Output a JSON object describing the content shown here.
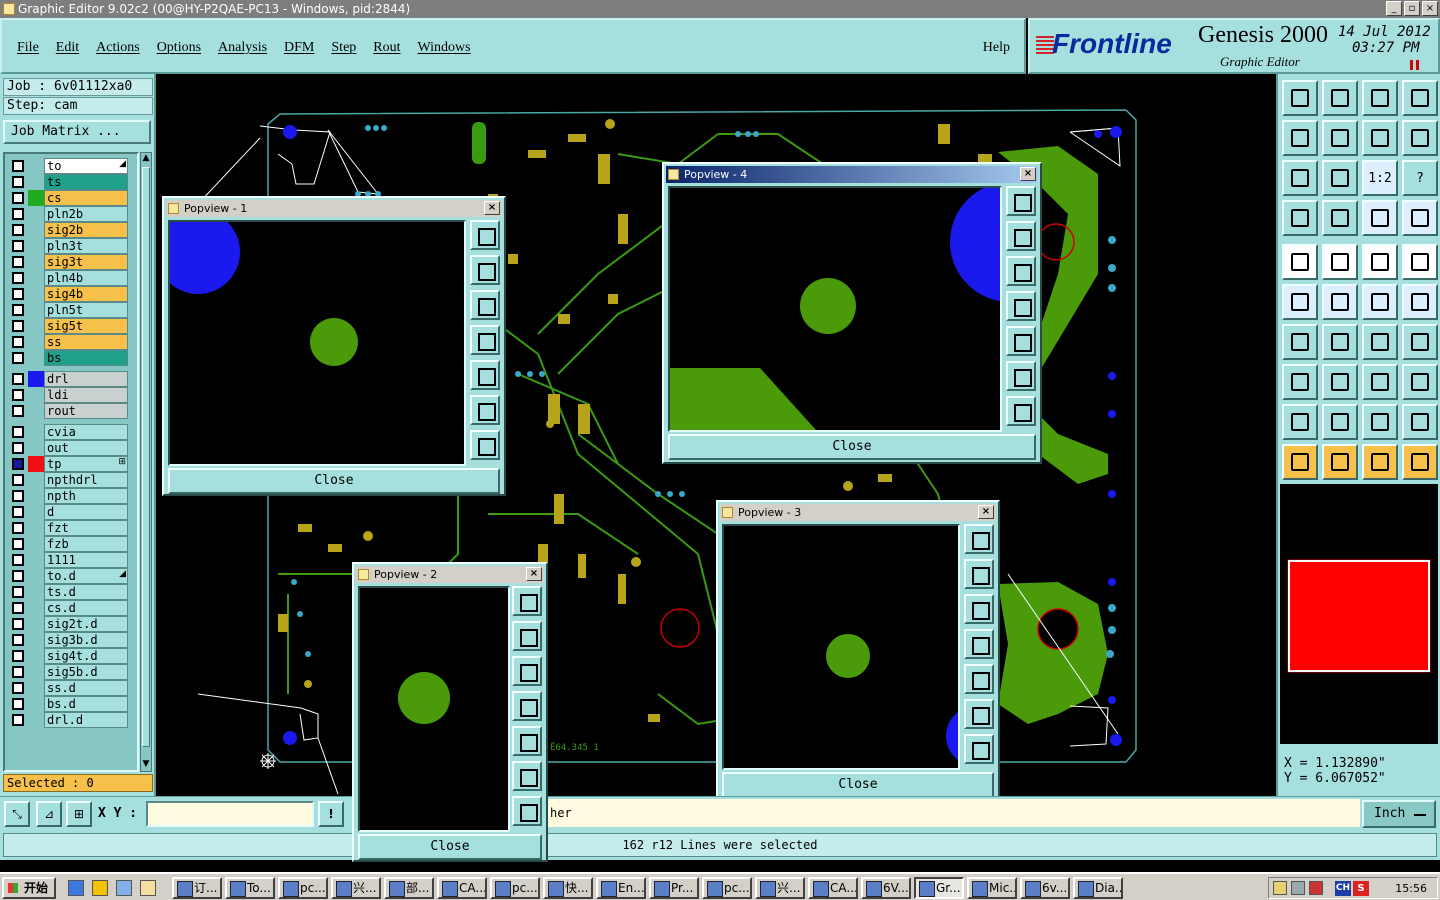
{
  "window": {
    "title": "Graphic Editor 9.02c2 (00@HY-P2QAE-PC13 - Windows, pid:2844)",
    "minimize": "_",
    "restore": "▫",
    "close": "×"
  },
  "menu": {
    "items": [
      "File",
      "Edit",
      "Actions",
      "Options",
      "Analysis",
      "DFM",
      "Step",
      "Rout",
      "Windows"
    ],
    "help": "Help"
  },
  "brand": {
    "logo": "Frontline",
    "product": "Genesis 2000",
    "subtitle": "Graphic Editor",
    "date": "14 Jul 2012",
    "time": "03:27 PM"
  },
  "job": {
    "job_line": "Job : 6v01112xa0",
    "step_line": "Step: cam",
    "matrix_button": "Job Matrix ..."
  },
  "layers": [
    {
      "name": "to",
      "bg": "#ffffff",
      "swatch": "",
      "mark": "◢"
    },
    {
      "name": "ts",
      "bg": "#1fa08a",
      "swatch": "",
      "mark": ""
    },
    {
      "name": "cs",
      "bg": "#f6c04a",
      "swatch": "#22aa22",
      "mark": ""
    },
    {
      "name": "pln2b",
      "bg": "#a6e0de",
      "swatch": "",
      "mark": ""
    },
    {
      "name": "sig2b",
      "bg": "#f6c04a",
      "swatch": "",
      "mark": ""
    },
    {
      "name": "pln3t",
      "bg": "#a6e0de",
      "swatch": "",
      "mark": ""
    },
    {
      "name": "sig3t",
      "bg": "#f6c04a",
      "swatch": "",
      "mark": ""
    },
    {
      "name": "pln4b",
      "bg": "#a6e0de",
      "swatch": "",
      "mark": ""
    },
    {
      "name": "sig4b",
      "bg": "#f6c04a",
      "swatch": "",
      "mark": ""
    },
    {
      "name": "pln5t",
      "bg": "#a6e0de",
      "swatch": "",
      "mark": ""
    },
    {
      "name": "sig5t",
      "bg": "#f6c04a",
      "swatch": "",
      "mark": ""
    },
    {
      "name": "ss",
      "bg": "#f6c04a",
      "swatch": "",
      "mark": ""
    },
    {
      "name": "bs",
      "bg": "#1fa08a",
      "swatch": "",
      "mark": ""
    },
    {
      "name": "drl",
      "bg": "#c8d0d0",
      "swatch": "#1a1aee",
      "mark": ""
    },
    {
      "name": "ldi",
      "bg": "#c8d0d0",
      "swatch": "",
      "mark": ""
    },
    {
      "name": "rout",
      "bg": "#c8d0d0",
      "swatch": "",
      "mark": ""
    },
    {
      "name": "cvia",
      "bg": "#a6e0de",
      "swatch": "",
      "mark": ""
    },
    {
      "name": "out",
      "bg": "#a6e0de",
      "swatch": "",
      "mark": ""
    },
    {
      "name": "tp",
      "bg": "#a6e0de",
      "swatch": "#ee1111",
      "mark": "⊞",
      "selected": true
    },
    {
      "name": "npthdrl",
      "bg": "#a6e0de",
      "swatch": "",
      "mark": ""
    },
    {
      "name": "npth",
      "bg": "#a6e0de",
      "swatch": "",
      "mark": ""
    },
    {
      "name": "d",
      "bg": "#a6e0de",
      "swatch": "",
      "mark": ""
    },
    {
      "name": "fzt",
      "bg": "#a6e0de",
      "swatch": "",
      "mark": ""
    },
    {
      "name": "fzb",
      "bg": "#a6e0de",
      "swatch": "",
      "mark": ""
    },
    {
      "name": "1111",
      "bg": "#a6e0de",
      "swatch": "",
      "mark": ""
    },
    {
      "name": "to.d",
      "bg": "#a6e0de",
      "swatch": "",
      "mark": "◢"
    },
    {
      "name": "ts.d",
      "bg": "#a6e0de",
      "swatch": "",
      "mark": ""
    },
    {
      "name": "cs.d",
      "bg": "#a6e0de",
      "swatch": "",
      "mark": ""
    },
    {
      "name": "sig2t.d",
      "bg": "#a6e0de",
      "swatch": "",
      "mark": ""
    },
    {
      "name": "sig3b.d",
      "bg": "#a6e0de",
      "swatch": "",
      "mark": ""
    },
    {
      "name": "sig4t.d",
      "bg": "#a6e0de",
      "swatch": "",
      "mark": ""
    },
    {
      "name": "sig5b.d",
      "bg": "#a6e0de",
      "swatch": "",
      "mark": ""
    },
    {
      "name": "ss.d",
      "bg": "#a6e0de",
      "swatch": "",
      "mark": ""
    },
    {
      "name": "bs.d",
      "bg": "#a6e0de",
      "swatch": "",
      "mark": ""
    },
    {
      "name": "drl.d",
      "bg": "#a6e0de",
      "swatch": "",
      "mark": ""
    }
  ],
  "selected_text": "Selected : 0",
  "xy": {
    "label": "X Y :",
    "value": "",
    "help_icon": "!",
    "message_fragment": "her"
  },
  "units": "Inch",
  "status": "162 r12 Lines were selected",
  "coords": {
    "x": "X = 1.132890\"",
    "y": "Y = 6.067052\""
  },
  "right_tool_labels": {
    "ratio": "1:2",
    "help": "?"
  },
  "popviews": [
    {
      "title": "Popview - 1",
      "close_label": "Close"
    },
    {
      "title": "Popview - 4",
      "close_label": "Close"
    },
    {
      "title": "Popview - 3",
      "close_label": "Close"
    },
    {
      "title": "Popview - 2",
      "close_label": "Close"
    }
  ],
  "popview_close_glyph": "×",
  "canvas_text": "Ë64.345 1",
  "taskbar": {
    "start": "开始",
    "items": [
      "订...",
      "To...",
      "pc...",
      "兴...",
      "部...",
      "CA...",
      "pc...",
      "快...",
      "En...",
      "Pr...",
      "pc...",
      "兴...",
      "CA...",
      "6V...",
      "Gr...",
      "Mic...",
      "6v...",
      "Dia..."
    ],
    "active_item": "Gr...",
    "tray_ch": "CH",
    "tray_s": "S",
    "clock": "15:56"
  },
  "colors": {
    "ui_bg": "#a6e0de",
    "copper_green": "#4a9a0a",
    "trace_gold": "#b8a41a",
    "drill_blue": "#1a1aee",
    "selection_red": "#ff0000",
    "layer_orange": "#f6c04a",
    "layer_teal": "#1fa08a"
  }
}
